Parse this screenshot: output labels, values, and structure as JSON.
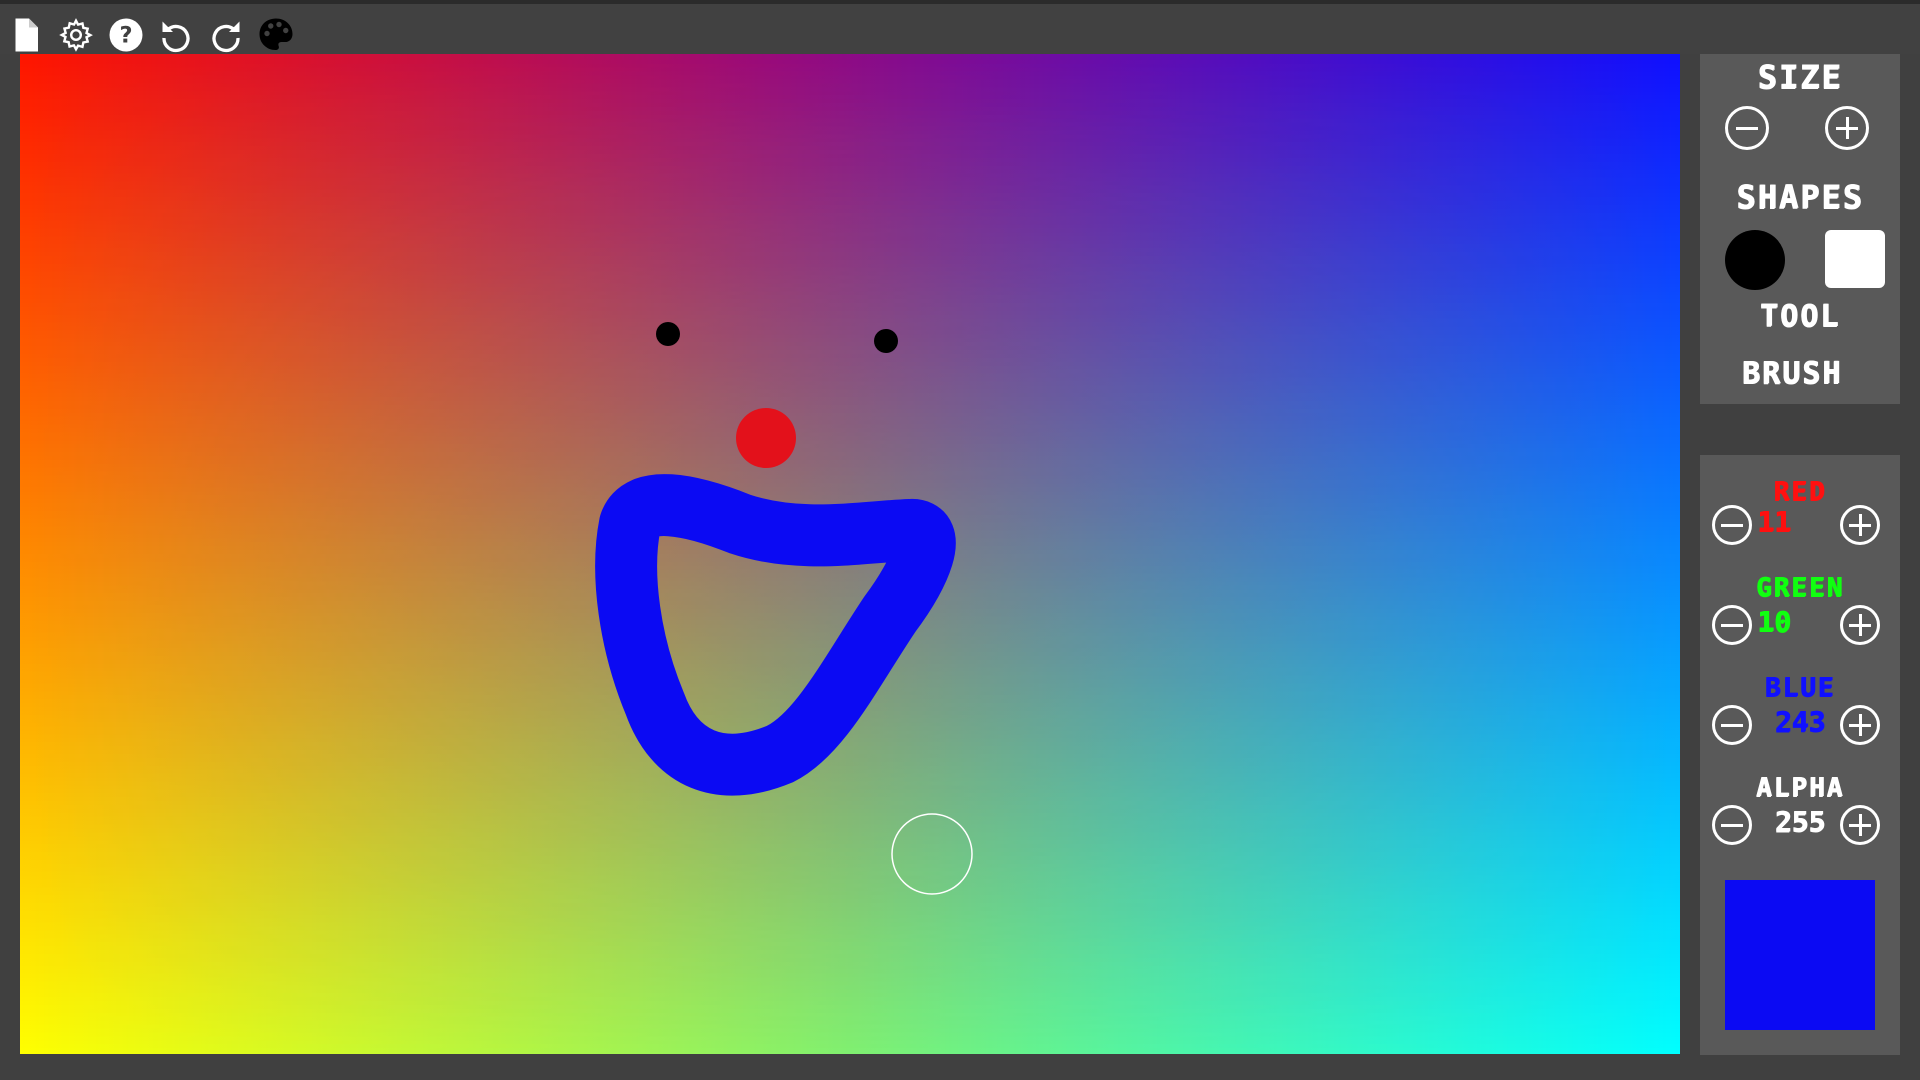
{
  "toolbar": {
    "buttons": [
      {
        "icon": "new-file-icon"
      },
      {
        "icon": "settings-gear-icon"
      },
      {
        "icon": "help-icon"
      },
      {
        "icon": "undo-icon"
      },
      {
        "icon": "redo-icon"
      },
      {
        "icon": "palette-icon"
      }
    ]
  },
  "panel": {
    "size_label": "Size",
    "shapes_label": "Shapes",
    "tool_label": "Tool",
    "tool_value": "Brush"
  },
  "color": {
    "red_label": "Red",
    "red_value": "11",
    "green_label": "Green",
    "green_value": "10",
    "blue_label": "Blue",
    "blue_value": "243",
    "alpha_label": "Alpha",
    "alpha_value": "255",
    "red_color": "#ff1010",
    "green_color": "#10ff10",
    "blue_color": "#1010ff",
    "preview_color": "#0b0af3"
  }
}
